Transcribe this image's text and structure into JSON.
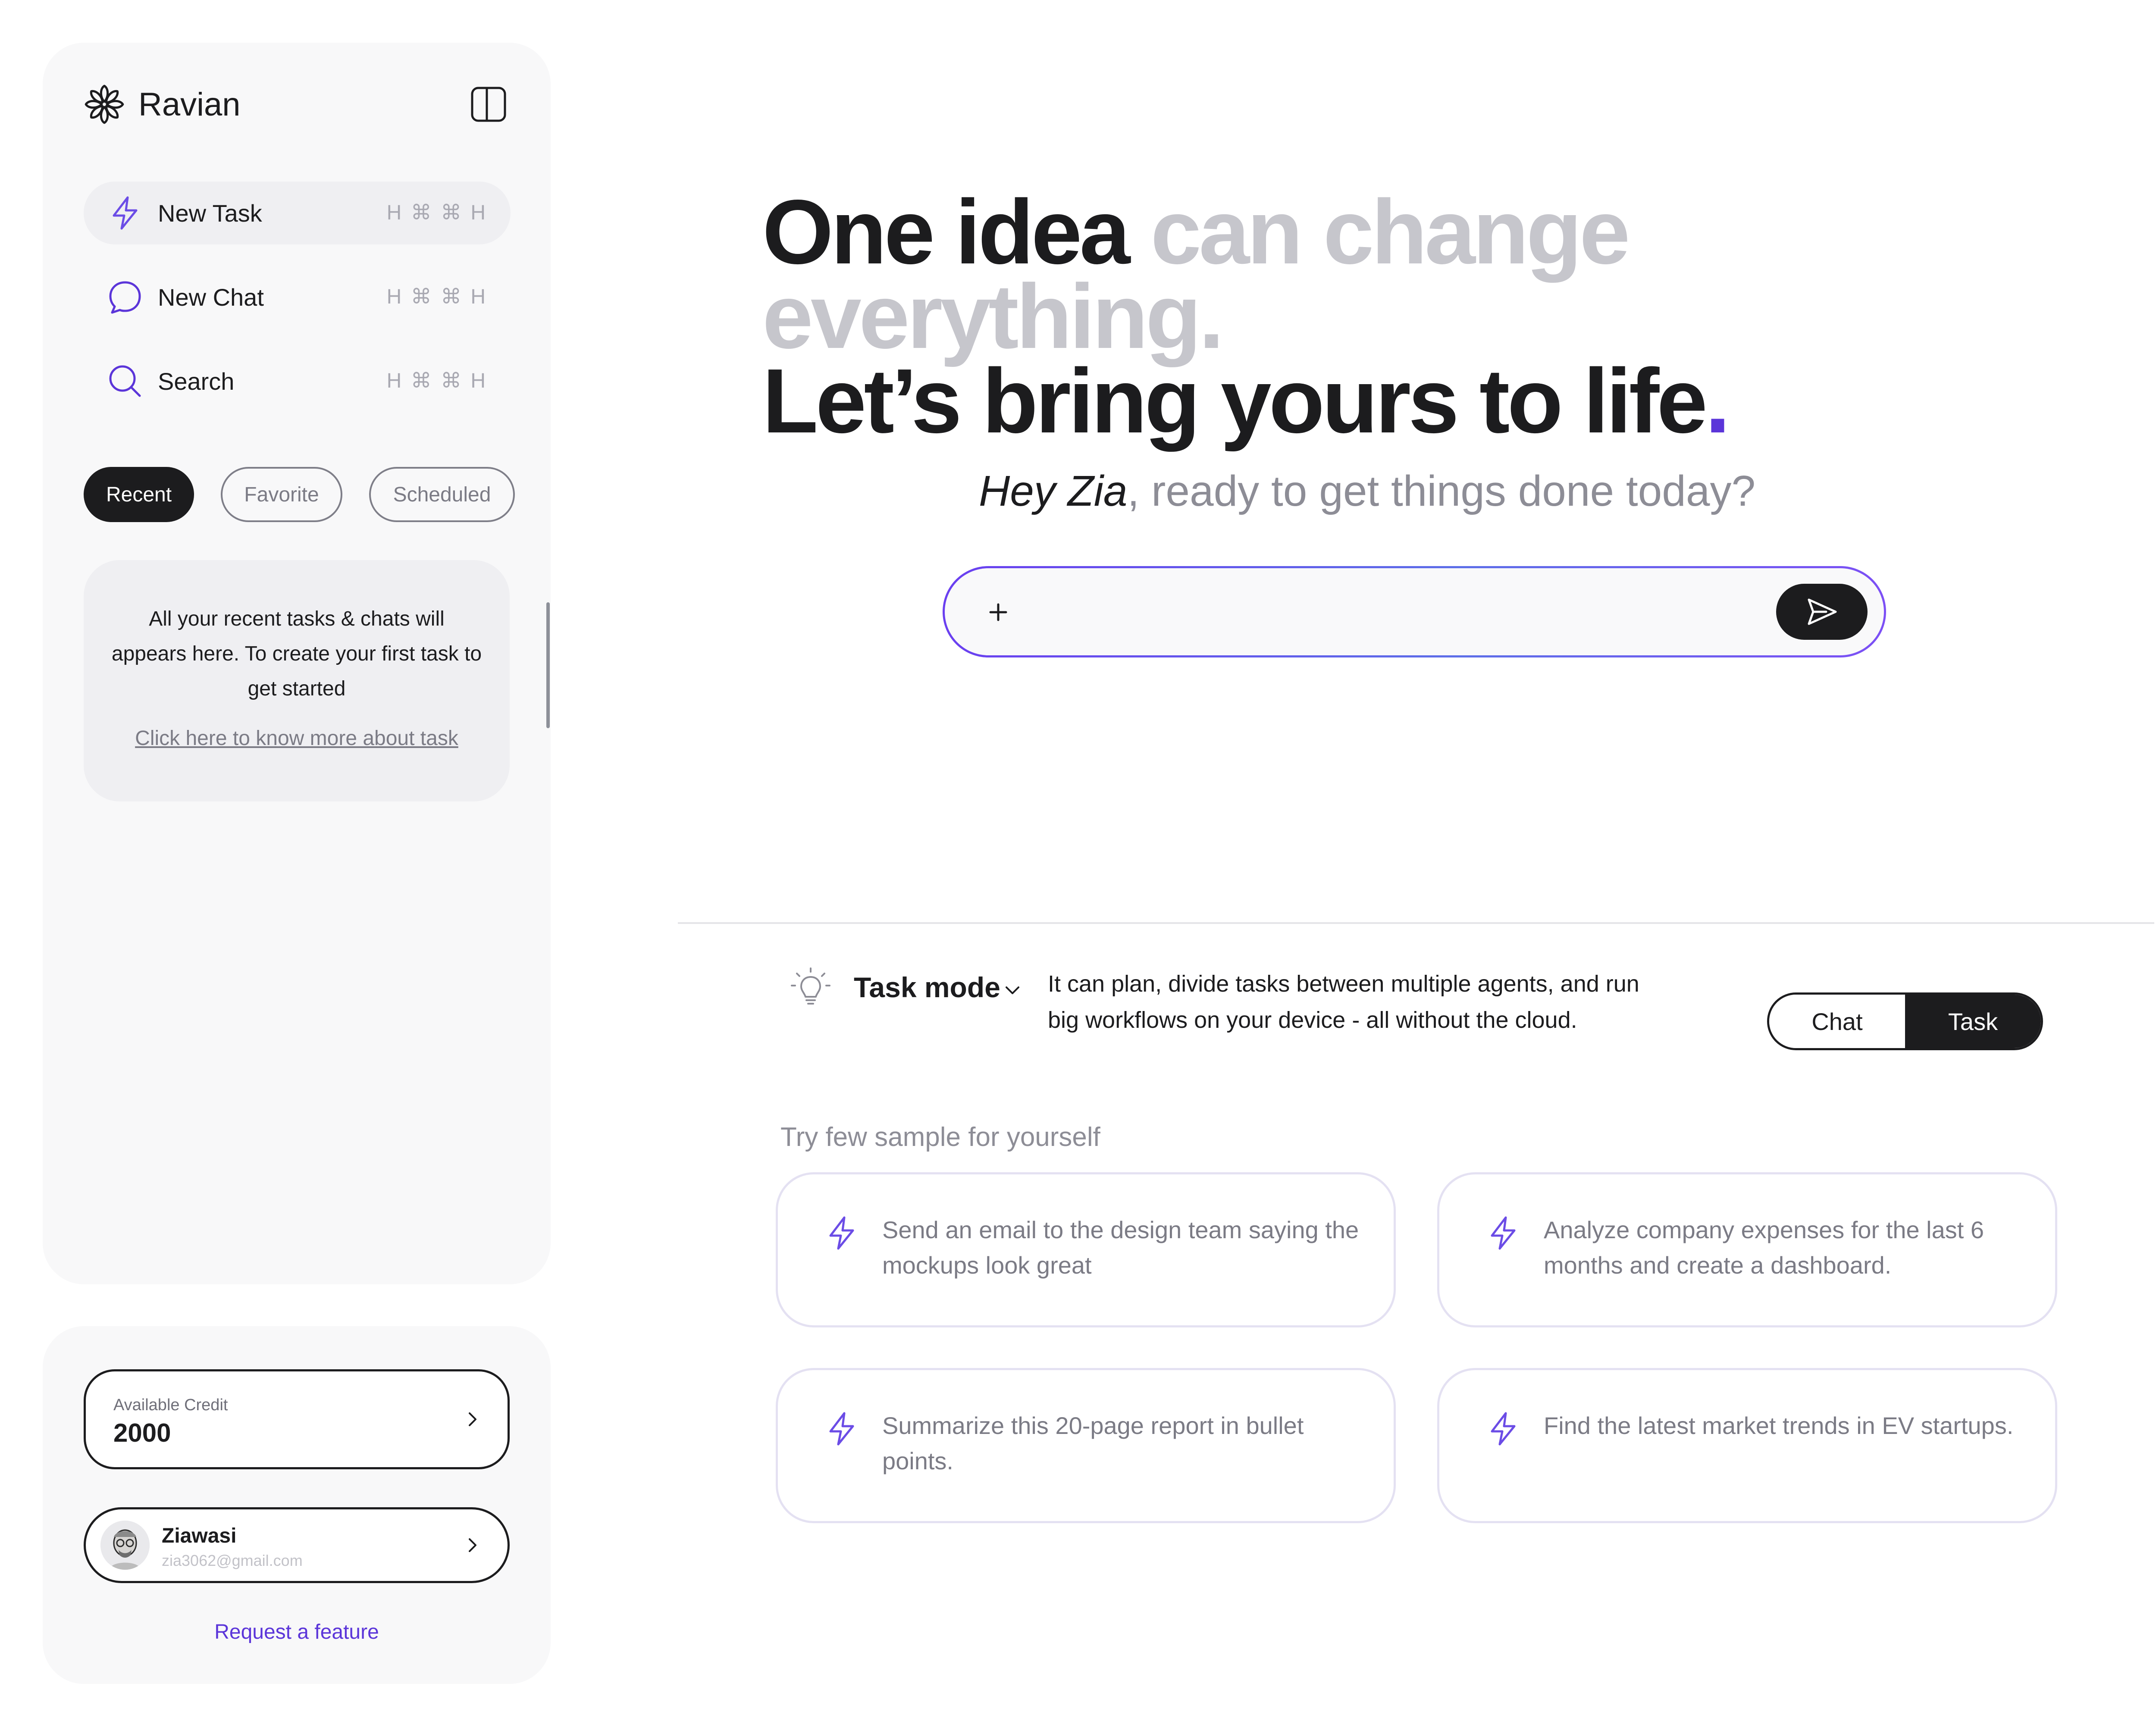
{
  "brand": {
    "name": "Ravian",
    "logo_icon": "asterisk-logo-icon",
    "toggle_icon": "panel-toggle-icon"
  },
  "sidebar": {
    "nav": [
      {
        "label": "New Task",
        "shortcut": "H ⌘ ⌘ H",
        "icon": "bolt-icon",
        "active": true
      },
      {
        "label": "New Chat",
        "shortcut": "H ⌘ ⌘ H",
        "icon": "chat-bubble-icon",
        "active": false
      },
      {
        "label": "Search",
        "shortcut": "H ⌘ ⌘ H",
        "icon": "search-icon",
        "active": false
      }
    ],
    "filters": [
      {
        "label": "Recent",
        "selected": true
      },
      {
        "label": "Favorite",
        "selected": false
      },
      {
        "label": "Scheduled",
        "selected": false
      }
    ],
    "empty_state": {
      "message": "All your recent tasks & chats will appears here. To create your first task to get started",
      "link": "Click here to know more about task"
    }
  },
  "account": {
    "credit_label": "Available Credit",
    "credit_value": "2000",
    "user_name": "Ziawasi",
    "user_email": "zia3062@gmail.com",
    "request_link": "Request a feature"
  },
  "hero": {
    "line1_dark": "One idea",
    "line1_muted": "can change everything.",
    "line2": "Let’s bring yours to life",
    "line2_dot": "."
  },
  "greeting": {
    "name": "Hey Zia",
    "rest": ", ready to get things done today?"
  },
  "prompt": {
    "plus_label": "+",
    "value": "",
    "placeholder": ""
  },
  "mode": {
    "title": "Task mode",
    "description": "It can plan, divide tasks between multiple agents, and run big workflows on your device - all without the cloud.",
    "toggle": [
      {
        "label": "Chat",
        "selected": false
      },
      {
        "label": "Task",
        "selected": true
      }
    ]
  },
  "samples": {
    "title": "Try few sample for yourself",
    "items": [
      "Send an email to the design team saying the mockups look great",
      "Analyze company expenses for the last 6 months and create a dashboard.",
      "Summarize this 20-page report in bullet points.",
      "Find the latest market trends in EV startups."
    ]
  },
  "colors": {
    "accent": "#5b35d9",
    "dark": "#1c1c1e",
    "muted": "#c6c6cc",
    "panel": "#f8f8f9"
  }
}
